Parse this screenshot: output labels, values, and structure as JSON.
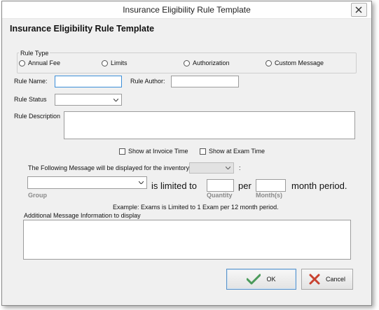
{
  "window": {
    "title": "Insurance Eligibility Rule Template"
  },
  "header": {
    "title": "Insurance Eligibility Rule Template"
  },
  "rule_type": {
    "label": "Rule Type",
    "options": [
      "Annual Fee",
      "Limits",
      "Authorization",
      "Custom Message"
    ]
  },
  "fields": {
    "rule_name_label": "Rule Name:",
    "rule_name_value": "",
    "rule_author_label": "Rule Author:",
    "rule_author_value": "",
    "rule_status_label": "Rule Status",
    "rule_status_value": "",
    "rule_description_label": "Rule Description",
    "rule_description_value": ""
  },
  "checks": {
    "show_invoice": "Show at Invoice Time",
    "show_exam": "Show at Exam Time"
  },
  "inventory": {
    "label": "The Following Message will be displayed for the inventory",
    "value": "",
    "colon": ":"
  },
  "limit": {
    "group_value": "",
    "is_limited_to": "is limited to",
    "per": "per",
    "month_period": "month period.",
    "group_label": "Group",
    "quantity_label": "Quantity",
    "months_label": "Month(s)",
    "quantity_value": "",
    "months_value": ""
  },
  "example": "Example: Exams is Limited to 1 Exam per 12 month period.",
  "additional": {
    "label": "Additional Message Information to display",
    "value": ""
  },
  "buttons": {
    "ok": "OK",
    "cancel": "Cancel"
  },
  "colors": {
    "ok_check": "#4a9a5a",
    "cancel_x": "#c8412f",
    "focus": "#3c8ed8"
  }
}
